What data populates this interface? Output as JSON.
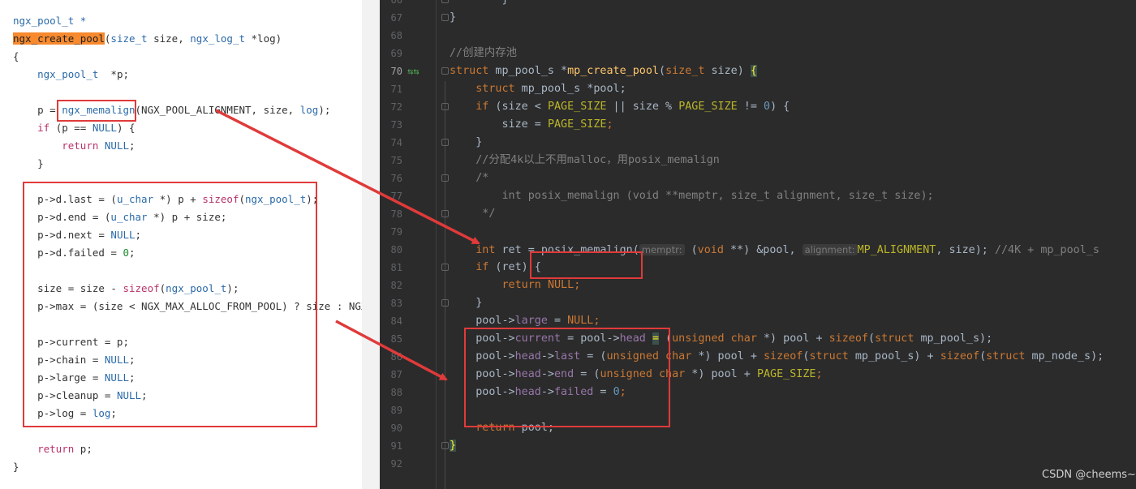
{
  "left_code": {
    "lines": [
      [
        [
          "ngx_pool_t *",
          "type"
        ]
      ],
      [
        [
          "ngx_create_pool",
          "hl"
        ],
        [
          "(",
          "plain"
        ],
        [
          "size_t",
          "type"
        ],
        [
          " size, ",
          "plain"
        ],
        [
          "ngx_log_t",
          "type"
        ],
        [
          " *log)",
          "plain"
        ]
      ],
      [
        [
          "{",
          "plain"
        ]
      ],
      [
        [
          "    ",
          "plain"
        ],
        [
          "ngx_pool_t",
          "type"
        ],
        [
          "  *p;",
          "plain"
        ]
      ],
      [
        [
          "",
          "plain"
        ]
      ],
      [
        [
          "    p = ",
          "plain"
        ],
        [
          "ngx_memalign",
          "type"
        ],
        [
          "(NGX_POOL_ALIGNMENT, size, ",
          "plain"
        ],
        [
          "log",
          "type"
        ],
        [
          ");",
          "plain"
        ]
      ],
      [
        [
          "    ",
          "plain"
        ],
        [
          "if",
          "kw"
        ],
        [
          " (p == ",
          "plain"
        ],
        [
          "NULL",
          "type"
        ],
        [
          ") {",
          "plain"
        ]
      ],
      [
        [
          "        ",
          "plain"
        ],
        [
          "return",
          "kw"
        ],
        [
          " ",
          "plain"
        ],
        [
          "NULL",
          "type"
        ],
        [
          ";",
          "plain"
        ]
      ],
      [
        [
          "    }",
          "plain"
        ]
      ],
      [
        [
          "",
          "plain"
        ]
      ],
      [
        [
          "    p->d.last = (",
          "plain"
        ],
        [
          "u_char",
          "type"
        ],
        [
          " *) p + ",
          "plain"
        ],
        [
          "sizeof",
          "kw"
        ],
        [
          "(",
          "plain"
        ],
        [
          "ngx_pool_t",
          "type"
        ],
        [
          ");",
          "plain"
        ]
      ],
      [
        [
          "    p->d.end = (",
          "plain"
        ],
        [
          "u_char",
          "type"
        ],
        [
          " *) p + size;",
          "plain"
        ]
      ],
      [
        [
          "    p->d.next = ",
          "plain"
        ],
        [
          "NULL",
          "type"
        ],
        [
          ";",
          "plain"
        ]
      ],
      [
        [
          "    p->d.failed = ",
          "plain"
        ],
        [
          "0",
          "num"
        ],
        [
          ";",
          "plain"
        ]
      ],
      [
        [
          "",
          "plain"
        ]
      ],
      [
        [
          "    size = size - ",
          "plain"
        ],
        [
          "sizeof",
          "kw"
        ],
        [
          "(",
          "plain"
        ],
        [
          "ngx_pool_t",
          "type"
        ],
        [
          ");",
          "plain"
        ]
      ],
      [
        [
          "    p->max = (size < NGX_MAX_ALLOC_FROM_POOL) ? size : NGX_MAX_ALLOC_FROM_POOL;",
          "plain"
        ]
      ],
      [
        [
          "",
          "plain"
        ]
      ],
      [
        [
          "    p->current = p;",
          "plain"
        ]
      ],
      [
        [
          "    p->chain = ",
          "plain"
        ],
        [
          "NULL",
          "type"
        ],
        [
          ";",
          "plain"
        ]
      ],
      [
        [
          "    p->large = ",
          "plain"
        ],
        [
          "NULL",
          "type"
        ],
        [
          ";",
          "plain"
        ]
      ],
      [
        [
          "    p->cleanup = ",
          "plain"
        ],
        [
          "NULL",
          "type"
        ],
        [
          ";",
          "plain"
        ]
      ],
      [
        [
          "    p->log = ",
          "plain"
        ],
        [
          "log",
          "type"
        ],
        [
          ";",
          "plain"
        ]
      ],
      [
        [
          "",
          "plain"
        ]
      ],
      [
        [
          "    ",
          "plain"
        ],
        [
          "return",
          "kw"
        ],
        [
          " p;",
          "plain"
        ]
      ],
      [
        [
          "}",
          "plain"
        ]
      ]
    ]
  },
  "editor": {
    "current_line": "70",
    "gutter_icons": "⇆⇆",
    "lines": [
      {
        "num": "66",
        "code": [
          [
            "        }",
            "p"
          ]
        ]
      },
      {
        "num": "67",
        "code": [
          [
            "}",
            "p"
          ]
        ]
      },
      {
        "num": "68",
        "code": [
          [
            "",
            "p"
          ]
        ]
      },
      {
        "num": "69",
        "code": [
          [
            "//创建内存池",
            "cm"
          ]
        ]
      },
      {
        "num": "70",
        "code": [
          [
            "struct",
            "kw"
          ],
          [
            " mp_pool_s *",
            "p"
          ],
          [
            "mp_create_pool",
            "fn"
          ],
          [
            "(",
            "p"
          ],
          [
            "size_t",
            "kw"
          ],
          [
            " size) ",
            "p"
          ],
          [
            "{",
            "br"
          ]
        ]
      },
      {
        "num": "71",
        "code": [
          [
            "    ",
            "p"
          ],
          [
            "struct",
            "kw"
          ],
          [
            " mp_pool_s *pool;",
            "p"
          ]
        ]
      },
      {
        "num": "72",
        "code": [
          [
            "    ",
            "p"
          ],
          [
            "if",
            "kw"
          ],
          [
            " (size < ",
            "p"
          ],
          [
            "PAGE_SIZE",
            "mac"
          ],
          [
            " || size % ",
            "p"
          ],
          [
            "PAGE_SIZE",
            "mac"
          ],
          [
            " != ",
            "p"
          ],
          [
            "0",
            "num"
          ],
          [
            ") {",
            "p"
          ]
        ]
      },
      {
        "num": "73",
        "code": [
          [
            "        size = ",
            "p"
          ],
          [
            "PAGE_SIZE",
            "mac"
          ],
          [
            ";",
            "kw"
          ]
        ]
      },
      {
        "num": "74",
        "code": [
          [
            "    }",
            "p"
          ]
        ]
      },
      {
        "num": "75",
        "code": [
          [
            "    //分配4k以上不用malloc，用posix_memalign",
            "cm"
          ]
        ]
      },
      {
        "num": "76",
        "code": [
          [
            "    /*",
            "cm"
          ]
        ]
      },
      {
        "num": "77",
        "code": [
          [
            "        int posix_memalign (void **memptr, size_t alignment, size_t size);",
            "cm"
          ]
        ]
      },
      {
        "num": "78",
        "code": [
          [
            "     */",
            "cm"
          ]
        ]
      },
      {
        "num": "79",
        "code": [
          [
            "",
            "p"
          ]
        ]
      },
      {
        "num": "80",
        "code": [
          [
            "    ",
            "p"
          ],
          [
            "int",
            "kw"
          ],
          [
            " ret = ",
            "p"
          ],
          [
            "posix_memalign(",
            "p"
          ],
          [
            "memptr:",
            "hint"
          ],
          [
            " (",
            "p"
          ],
          [
            "void",
            "kw"
          ],
          [
            " **) &pool, ",
            "p"
          ],
          [
            "alignment:",
            "hint"
          ],
          [
            "MP_ALIGNMENT",
            "mac"
          ],
          [
            ", size); ",
            "p"
          ],
          [
            "//4K + mp_pool_s",
            "cm"
          ]
        ]
      },
      {
        "num": "81",
        "code": [
          [
            "    ",
            "p"
          ],
          [
            "if",
            "kw"
          ],
          [
            " (ret) {",
            "p"
          ]
        ]
      },
      {
        "num": "82",
        "code": [
          [
            "        ",
            "p"
          ],
          [
            "return",
            "kw"
          ],
          [
            " ",
            "p"
          ],
          [
            "NULL",
            "kw"
          ],
          [
            ";",
            "kw"
          ]
        ]
      },
      {
        "num": "83",
        "code": [
          [
            "    }",
            "p"
          ]
        ]
      },
      {
        "num": "84",
        "code": [
          [
            "    pool->",
            "p"
          ],
          [
            "large",
            "fld"
          ],
          [
            " = ",
            "p"
          ],
          [
            "NULL",
            "kw"
          ],
          [
            ";",
            "kw"
          ]
        ]
      },
      {
        "num": "85",
        "code": [
          [
            "    pool->",
            "p"
          ],
          [
            "current",
            "fld"
          ],
          [
            " = pool->",
            "p"
          ],
          [
            "head",
            "fld"
          ],
          [
            " ",
            "p"
          ],
          [
            "=",
            "br"
          ],
          [
            " (",
            "p"
          ],
          [
            "unsigned char",
            "kw"
          ],
          [
            " *) pool + ",
            "p"
          ],
          [
            "sizeof",
            "kw"
          ],
          [
            "(",
            "p"
          ],
          [
            "struct",
            "kw"
          ],
          [
            " mp_pool_s);",
            "p"
          ]
        ]
      },
      {
        "num": "86",
        "code": [
          [
            "    pool->",
            "p"
          ],
          [
            "head",
            "fld"
          ],
          [
            "->",
            "p"
          ],
          [
            "last",
            "fld"
          ],
          [
            " = (",
            "p"
          ],
          [
            "unsigned char",
            "kw"
          ],
          [
            " *) pool + ",
            "p"
          ],
          [
            "sizeof",
            "kw"
          ],
          [
            "(",
            "p"
          ],
          [
            "struct",
            "kw"
          ],
          [
            " mp_pool_s) + ",
            "p"
          ],
          [
            "sizeof",
            "kw"
          ],
          [
            "(",
            "p"
          ],
          [
            "struct",
            "kw"
          ],
          [
            " mp_node_s);",
            "p"
          ]
        ]
      },
      {
        "num": "87",
        "code": [
          [
            "    pool->",
            "p"
          ],
          [
            "head",
            "fld"
          ],
          [
            "->",
            "p"
          ],
          [
            "end",
            "fld"
          ],
          [
            " = (",
            "p"
          ],
          [
            "unsigned char",
            "kw"
          ],
          [
            " *) pool + ",
            "p"
          ],
          [
            "PAGE_SIZE",
            "mac"
          ],
          [
            ";",
            "kw"
          ]
        ]
      },
      {
        "num": "88",
        "code": [
          [
            "    pool->",
            "p"
          ],
          [
            "head",
            "fld"
          ],
          [
            "->",
            "p"
          ],
          [
            "failed",
            "fld"
          ],
          [
            " = ",
            "p"
          ],
          [
            "0",
            "num"
          ],
          [
            ";",
            "kw"
          ]
        ]
      },
      {
        "num": "89",
        "code": [
          [
            "",
            "p"
          ]
        ]
      },
      {
        "num": "90",
        "code": [
          [
            "    ",
            "p"
          ],
          [
            "return",
            "kw"
          ],
          [
            " pool;",
            "p"
          ]
        ]
      },
      {
        "num": "91",
        "code": [
          [
            "}",
            "br"
          ]
        ]
      },
      {
        "num": "92",
        "code": [
          [
            "",
            "p"
          ]
        ]
      }
    ]
  },
  "watermark": "CSDN @cheems~",
  "colors": {
    "annotation": "#e03a3a",
    "editor_bg": "#2b2b2b",
    "keyword": "#cc7832",
    "function": "#ffc66d"
  }
}
